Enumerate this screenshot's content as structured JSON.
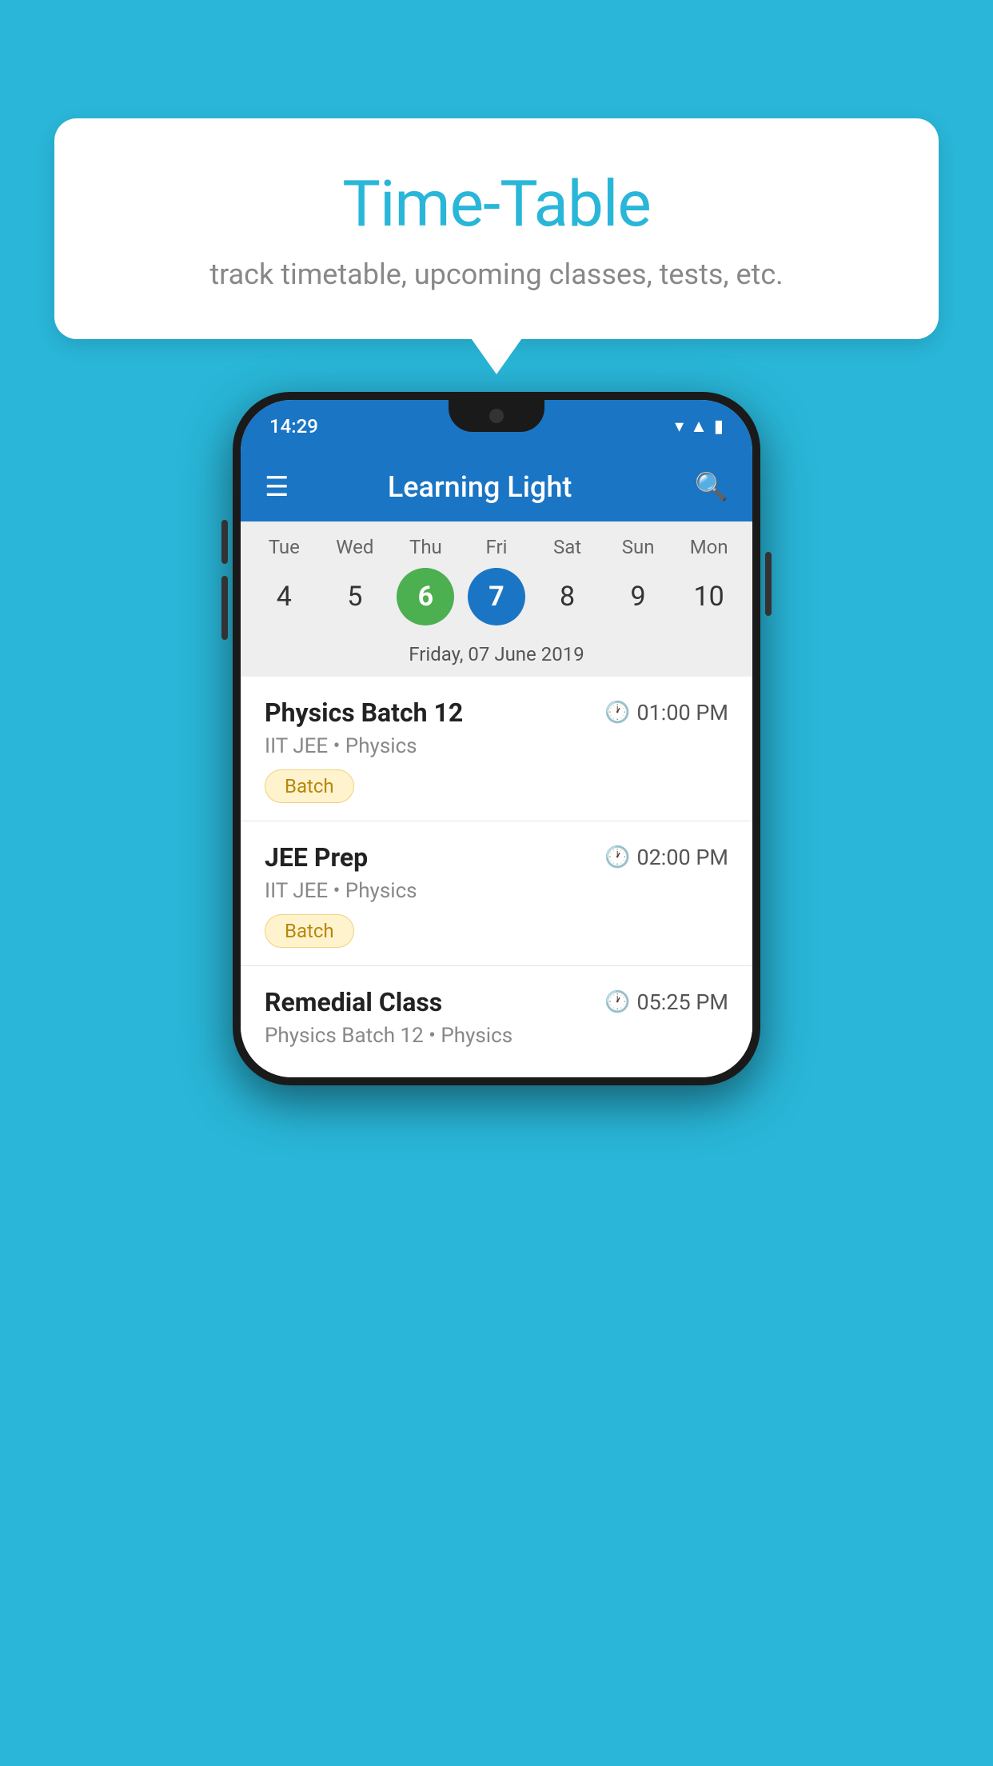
{
  "background_color": "#29b6d8",
  "speech_bubble": {
    "title": "Time-Table",
    "subtitle": "track timetable, upcoming classes, tests, etc."
  },
  "phone": {
    "status_bar": {
      "time": "14:29"
    },
    "app_bar": {
      "title": "Learning Light"
    },
    "calendar": {
      "days": [
        {
          "label": "Tue",
          "num": "4"
        },
        {
          "label": "Wed",
          "num": "5"
        },
        {
          "label": "Thu",
          "num": "6",
          "state": "today"
        },
        {
          "label": "Fri",
          "num": "7",
          "state": "selected"
        },
        {
          "label": "Sat",
          "num": "8"
        },
        {
          "label": "Sun",
          "num": "9"
        },
        {
          "label": "Mon",
          "num": "10"
        }
      ],
      "selected_date": "Friday, 07 June 2019"
    },
    "schedule_items": [
      {
        "title": "Physics Batch 12",
        "time": "01:00 PM",
        "subtitle": "IIT JEE • Physics",
        "tag": "Batch"
      },
      {
        "title": "JEE Prep",
        "time": "02:00 PM",
        "subtitle": "IIT JEE • Physics",
        "tag": "Batch"
      },
      {
        "title": "Remedial Class",
        "time": "05:25 PM",
        "subtitle": "Physics Batch 12 • Physics",
        "tag": ""
      }
    ]
  }
}
